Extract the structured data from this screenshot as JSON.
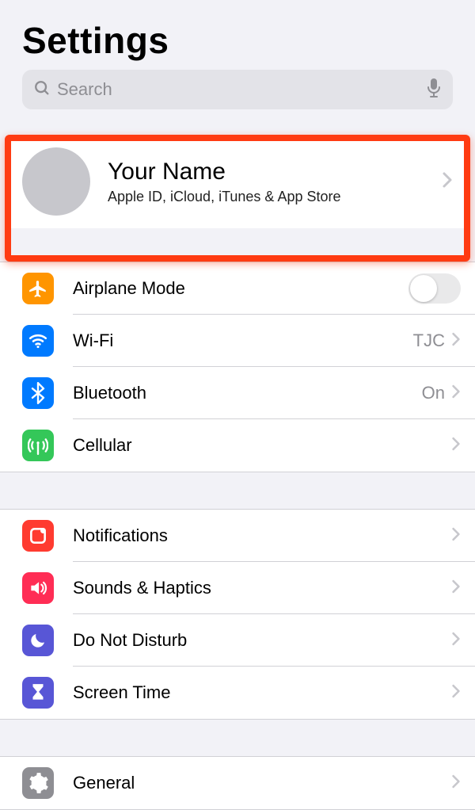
{
  "header": {
    "title": "Settings"
  },
  "search": {
    "placeholder": "Search"
  },
  "account": {
    "name": "Your Name",
    "subtitle": "Apple ID, iCloud, iTunes & App Store"
  },
  "group1": {
    "airplane": {
      "label": "Airplane Mode"
    },
    "wifi": {
      "label": "Wi-Fi",
      "value": "TJC"
    },
    "bluetooth": {
      "label": "Bluetooth",
      "value": "On"
    },
    "cellular": {
      "label": "Cellular"
    }
  },
  "group2": {
    "notifications": {
      "label": "Notifications"
    },
    "sounds": {
      "label": "Sounds & Haptics"
    },
    "dnd": {
      "label": "Do Not Disturb"
    },
    "screentime": {
      "label": "Screen Time"
    }
  },
  "group3": {
    "general": {
      "label": "General"
    }
  }
}
